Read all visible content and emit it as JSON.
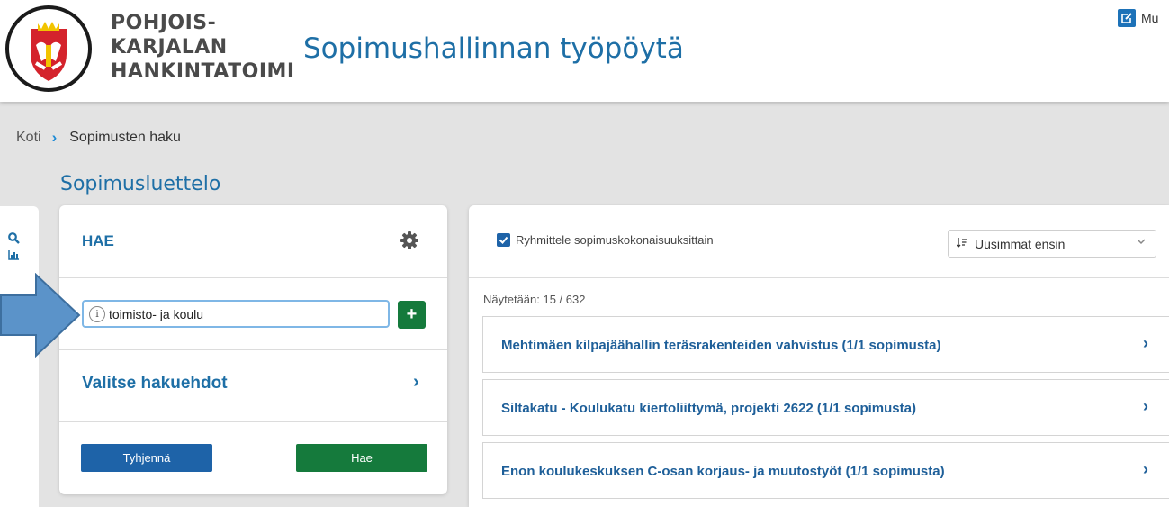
{
  "header": {
    "org_line1": "POHJOIS-",
    "org_line2": "KARJALAN",
    "org_line3": "HANKINTATOIMI",
    "app_title": "Sopimushallinnan työpöytä",
    "edit_label": "Mu"
  },
  "breadcrumb": {
    "home": "Koti",
    "current": "Sopimusten haku"
  },
  "page_title": "Sopimusluettelo",
  "search_panel": {
    "title": "HAE",
    "search_value": "toimisto- ja koulu",
    "info_glyph": "i",
    "add_label": "+",
    "criteria_label": "Valitse hakuehdot",
    "clear_label": "Tyhjennä",
    "search_label": "Hae"
  },
  "results": {
    "group_label": "Ryhmittele sopimuskokonaisuuksittain",
    "group_checked": true,
    "sort_value": "Uusimmat ensin",
    "count_text": "Näytetään: 15 / 632",
    "items": [
      {
        "title": "Mehtimäen kilpajäähallin teräsrakenteiden vahvistus (1/1 sopimusta)"
      },
      {
        "title": "Siltakatu - Koulukatu kiertoliittymä, projekti 2622 (1/1 sopimusta)"
      },
      {
        "title": "Enon koulukeskuksen C-osan korjaus- ja muutostyöt (1/1 sopimusta)"
      }
    ]
  },
  "icons": {
    "logo": "coat-of-arms-icon",
    "gear": "gear-icon",
    "search": "search-icon",
    "chart": "bar-chart-icon",
    "edit": "edit-icon",
    "sort": "sort-icon",
    "chevron": "chevron-right-icon"
  },
  "colors": {
    "brand_blue": "#1e6fa6",
    "action_green": "#157a3c",
    "button_blue": "#1e63a8",
    "background": "#e3e3e3"
  }
}
